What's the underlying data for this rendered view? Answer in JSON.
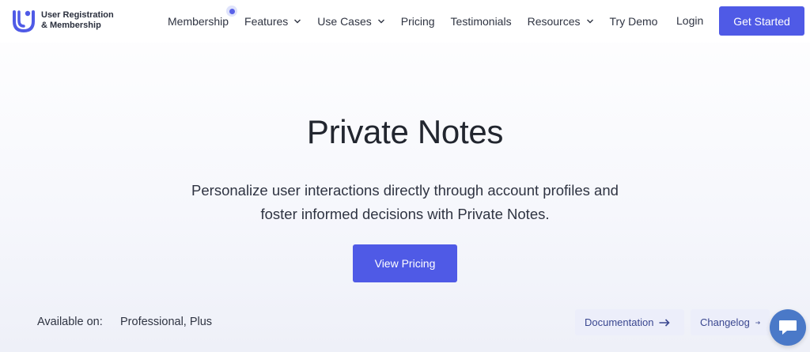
{
  "brand": {
    "name_line1": "User Registration",
    "name_line2": "& Membership",
    "logo_icon": "ur-logo-icon",
    "accent_color": "#4f5ae6"
  },
  "nav": {
    "items": [
      {
        "label": "Membership",
        "has_badge": true
      },
      {
        "label": "Features",
        "has_dropdown": true
      },
      {
        "label": "Use Cases",
        "has_dropdown": true
      },
      {
        "label": "Pricing"
      },
      {
        "label": "Testimonials"
      },
      {
        "label": "Resources",
        "has_dropdown": true
      },
      {
        "label": "Try Demo"
      }
    ],
    "login": "Login",
    "cta": "Get Started"
  },
  "hero": {
    "title": "Private Notes",
    "subtitle_line1": "Personalize user interactions directly through account profiles and",
    "subtitle_line2": "foster informed decisions with Private Notes.",
    "cta": "View Pricing"
  },
  "availability": {
    "label": "Available on:",
    "value": "Professional, Plus"
  },
  "links": {
    "documentation": "Documentation",
    "changelog": "Changelog"
  },
  "chat": {
    "icon": "chat-icon",
    "color": "#4a79c8"
  }
}
